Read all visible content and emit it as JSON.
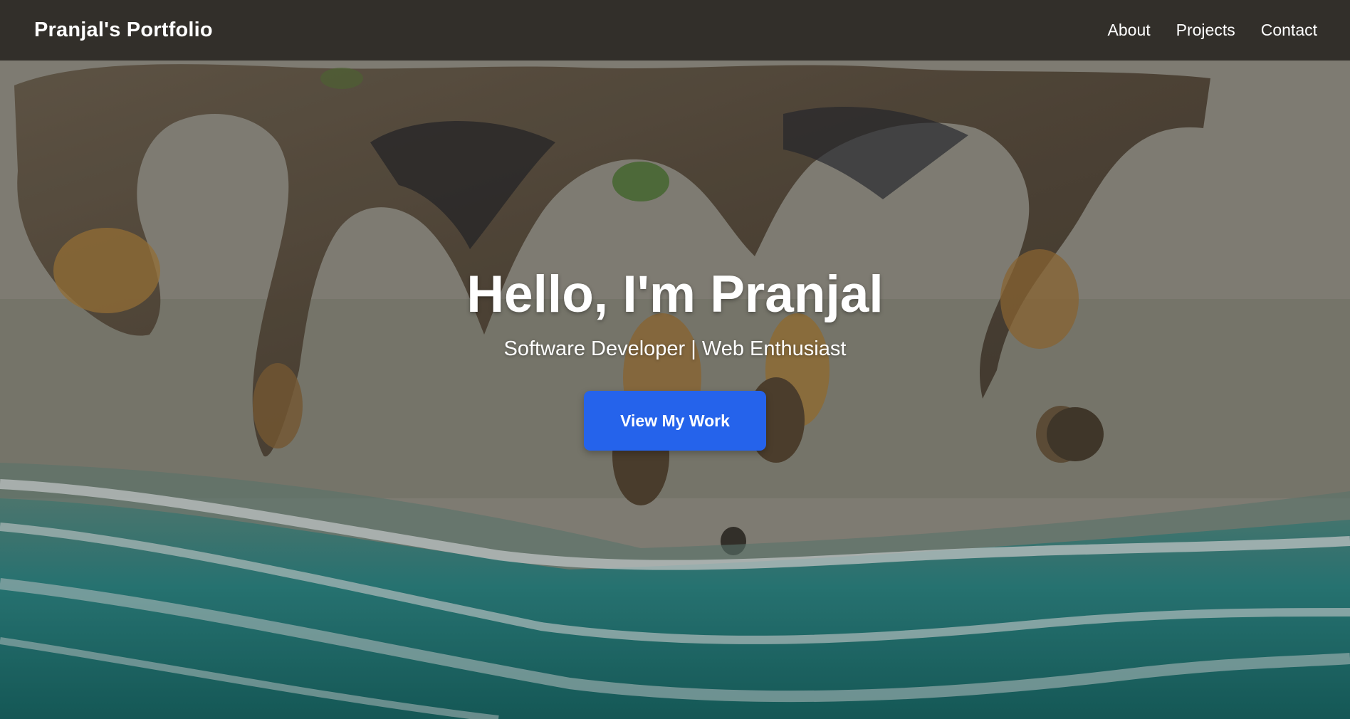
{
  "nav": {
    "brand": "Pranjal's Portfolio",
    "links": [
      {
        "label": "About"
      },
      {
        "label": "Projects"
      },
      {
        "label": "Contact"
      }
    ]
  },
  "hero": {
    "title": "Hello, I'm Pranjal",
    "subtitle": "Software Developer | Web Enthusiast",
    "cta_label": "View My Work",
    "background_image": "aerial view of rocky coastline with sandy beach and turquoise ocean waves"
  },
  "colors": {
    "accent": "#2563eb",
    "nav_background": "rgba(28,26,22,0.78)",
    "text": "#ffffff"
  }
}
